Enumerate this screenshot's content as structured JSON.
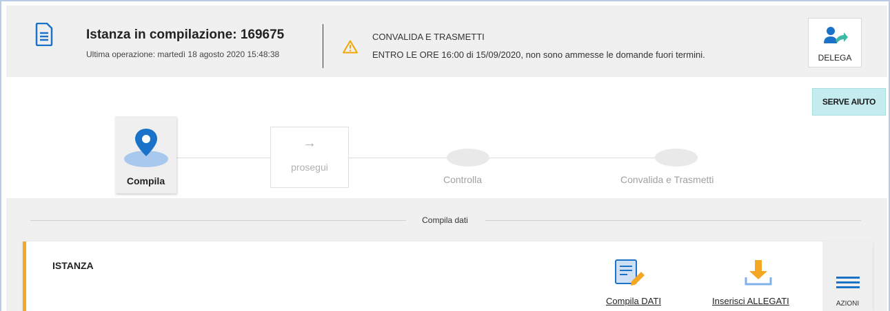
{
  "header": {
    "title": "Istanza in compilazione: 169675",
    "subtitle": "Ultima operazione: martedì 18 agosto 2020 15:48:38",
    "warning_title": "CONVALIDA E TRASMETTI",
    "warning_text": "ENTRO LE ORE 16:00 di 15/09/2020, non sono ammesse le domande fuori termini.",
    "delega_label": "DELEGA"
  },
  "help_button": "SERVE AIUTO",
  "stepper": {
    "compila": "Compila",
    "prosegui": "prosegui",
    "prosegui_arrow": "→",
    "controlla": "Controlla",
    "convalida": "Convalida e Trasmetti"
  },
  "section": {
    "title": "Compila dati",
    "card_title": "ISTANZA",
    "compila_dati": "Compila DATI",
    "inserisci_allegati": "Inserisci ALLEGATI",
    "azioni": "AZIONI"
  },
  "colors": {
    "accent_blue": "#1a73c8",
    "orange": "#f5a623",
    "help_bg": "#c5ecef",
    "teal": "#3fb8a6"
  }
}
